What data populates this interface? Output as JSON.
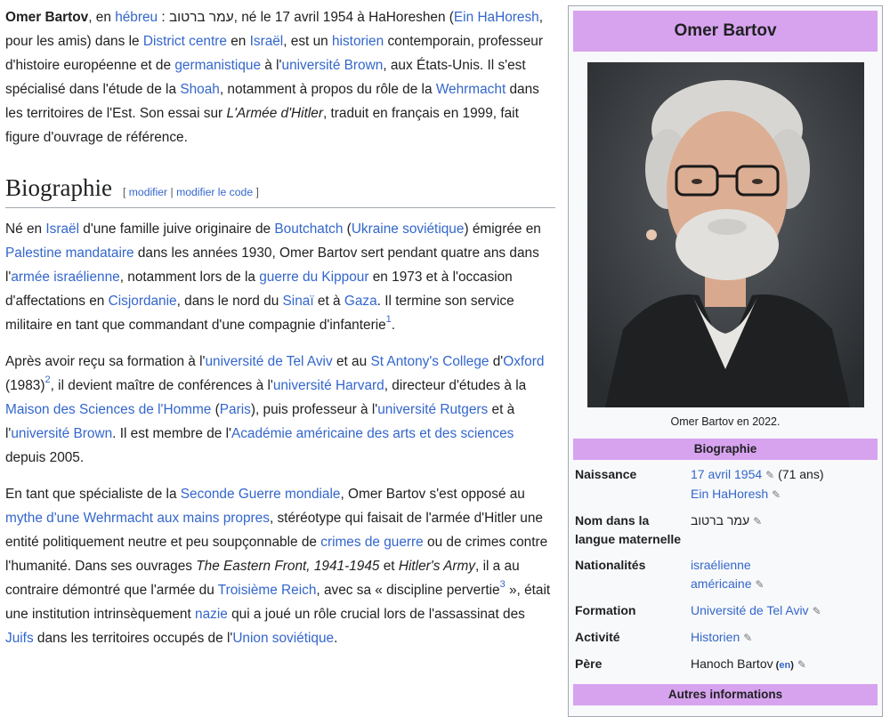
{
  "intro": {
    "name": "Omer Bartov",
    "t1": ", en ",
    "l_hebrew": "hébreu",
    "t2": " : עמר ברטוב, né le 17 avril 1954 à HaHoreshen (",
    "l_ein": "Ein HaHoresh",
    "t3": ", pour les amis) dans le ",
    "l_district": "District centre",
    "t4": " en ",
    "l_israel": "Israël",
    "t5": ", est un ",
    "l_historien": "historien",
    "t6": " contemporain, professeur d'histoire européenne et de ",
    "l_germanistique": "germanistique",
    "t7": " à l'",
    "l_brown": "université Brown",
    "t8": ", aux États-Unis. Il s'est spécialisé dans l'étude de la ",
    "l_shoah": "Shoah",
    "t9": ", notamment à propos du rôle de la ",
    "l_wehrmacht": "Wehrmacht",
    "t10": " dans les territoires de l'Est. Son essai sur ",
    "i_armee": "L'Armée d'Hitler",
    "t11": ", traduit en français en 1999, fait figure d'ouvrage de référence."
  },
  "section": {
    "title": "Biographie",
    "edit_open": "[ ",
    "edit_modifier": "modifier",
    "edit_sep": " | ",
    "edit_code": "modifier le code",
    "edit_close": " ]"
  },
  "p1": {
    "t1": "Né en ",
    "l_israel": "Israël",
    "t2": " d'une famille juive originaire de ",
    "l_boutchatch": "Boutchatch",
    "t3": " (",
    "l_ukraine": "Ukraine soviétique",
    "t4": ") émigrée en ",
    "l_palestine": "Palestine mandataire",
    "t5": " dans les années 1930, Omer Bartov sert pendant quatre ans dans l'",
    "l_armee": "armée israélienne",
    "t6": ", notamment lors de la ",
    "l_kippour": "guerre du Kippour",
    "t7": " en 1973 et à l'occasion d'affectations en ",
    "l_cisjordanie": "Cisjordanie",
    "t8": ", dans le nord du ",
    "l_sinai": "Sinaï",
    "t9": " et à ",
    "l_gaza": "Gaza",
    "t10": ". Il termine son service militaire en tant que commandant d'une compagnie d'infanterie",
    "ref": "1",
    "t11": "."
  },
  "p2": {
    "t1": "Après avoir reçu sa formation à l'",
    "l_telaviv": "université de Tel Aviv",
    "t2": " et au ",
    "l_stantony": "St Antony's College",
    "t3": " d'",
    "l_oxford": "Oxford",
    "t4": " (1983)",
    "ref": "2",
    "t5": ", il devient maître de conférences à l'",
    "l_harvard": "université Harvard",
    "t6": ", directeur d'études à la ",
    "l_maison": "Maison des Sciences de l'Homme",
    "t7": " (",
    "l_paris": "Paris",
    "t8": "), puis professeur à l'",
    "l_rutgers": "université Rutgers",
    "t9": " et à l'",
    "l_brown": "université Brown",
    "t10": ". Il est membre de l'",
    "l_academie": "Académie américaine des arts et des sciences",
    "t11": " depuis 2005."
  },
  "p3": {
    "t1": "En tant que spécialiste de la ",
    "l_seconde": "Seconde Guerre mondiale",
    "t2": ", Omer Bartov s'est opposé au ",
    "l_mythe": "mythe d'une Wehrmacht aux mains propres",
    "t3": ", stéréotype qui faisait de l'armée d'Hitler une entité politiquement neutre et peu soupçonnable de ",
    "l_crimes": "crimes de guerre",
    "t4": " ou de crimes contre l'humanité. Dans ses ouvrages ",
    "i_eastern": "The Eastern Front, 1941-1945",
    "t5": " et ",
    "i_hitler": "Hitler's Army",
    "t6": ", il a au contraire démontré que l'armée du ",
    "l_reich": "Troisième Reich",
    "t7": ", avec sa « discipline pervertie",
    "ref": "3",
    "t8": " », était une institution intrinsèquement ",
    "l_nazie": "nazie",
    "t9": " qui a joué un rôle crucial lors de l'assassinat des ",
    "l_juifs": "Juifs",
    "t10": " dans les territoires occupés de l'",
    "l_union": "Union soviétique",
    "t11": "."
  },
  "infobox": {
    "title": "Omer Bartov",
    "photo_caption": "Omer Bartov en 2022.",
    "section_bio": "Biographie",
    "section_other": "Autres informations",
    "rows": {
      "naissance": {
        "label": "Naissance",
        "date": "17 avril 1954",
        "age": " (71 ans)",
        "place": "Ein HaHoresh"
      },
      "nom": {
        "label": "Nom dans la langue maternelle",
        "value": "עמר ברטוב"
      },
      "nat": {
        "label": "Nationalités",
        "v1": "israélienne",
        "v2": "américaine"
      },
      "formation": {
        "label": "Formation",
        "value": "Université de Tel Aviv"
      },
      "activite": {
        "label": "Activité",
        "value": "Historien"
      },
      "pere": {
        "label": "Père",
        "value": "Hanoch Bartov",
        "en_open": " (",
        "en": "en",
        "en_close": ")"
      }
    },
    "pencil": "✎",
    "colors": {
      "header_bg": "#d7a3ef",
      "link": "#3366cc"
    }
  }
}
